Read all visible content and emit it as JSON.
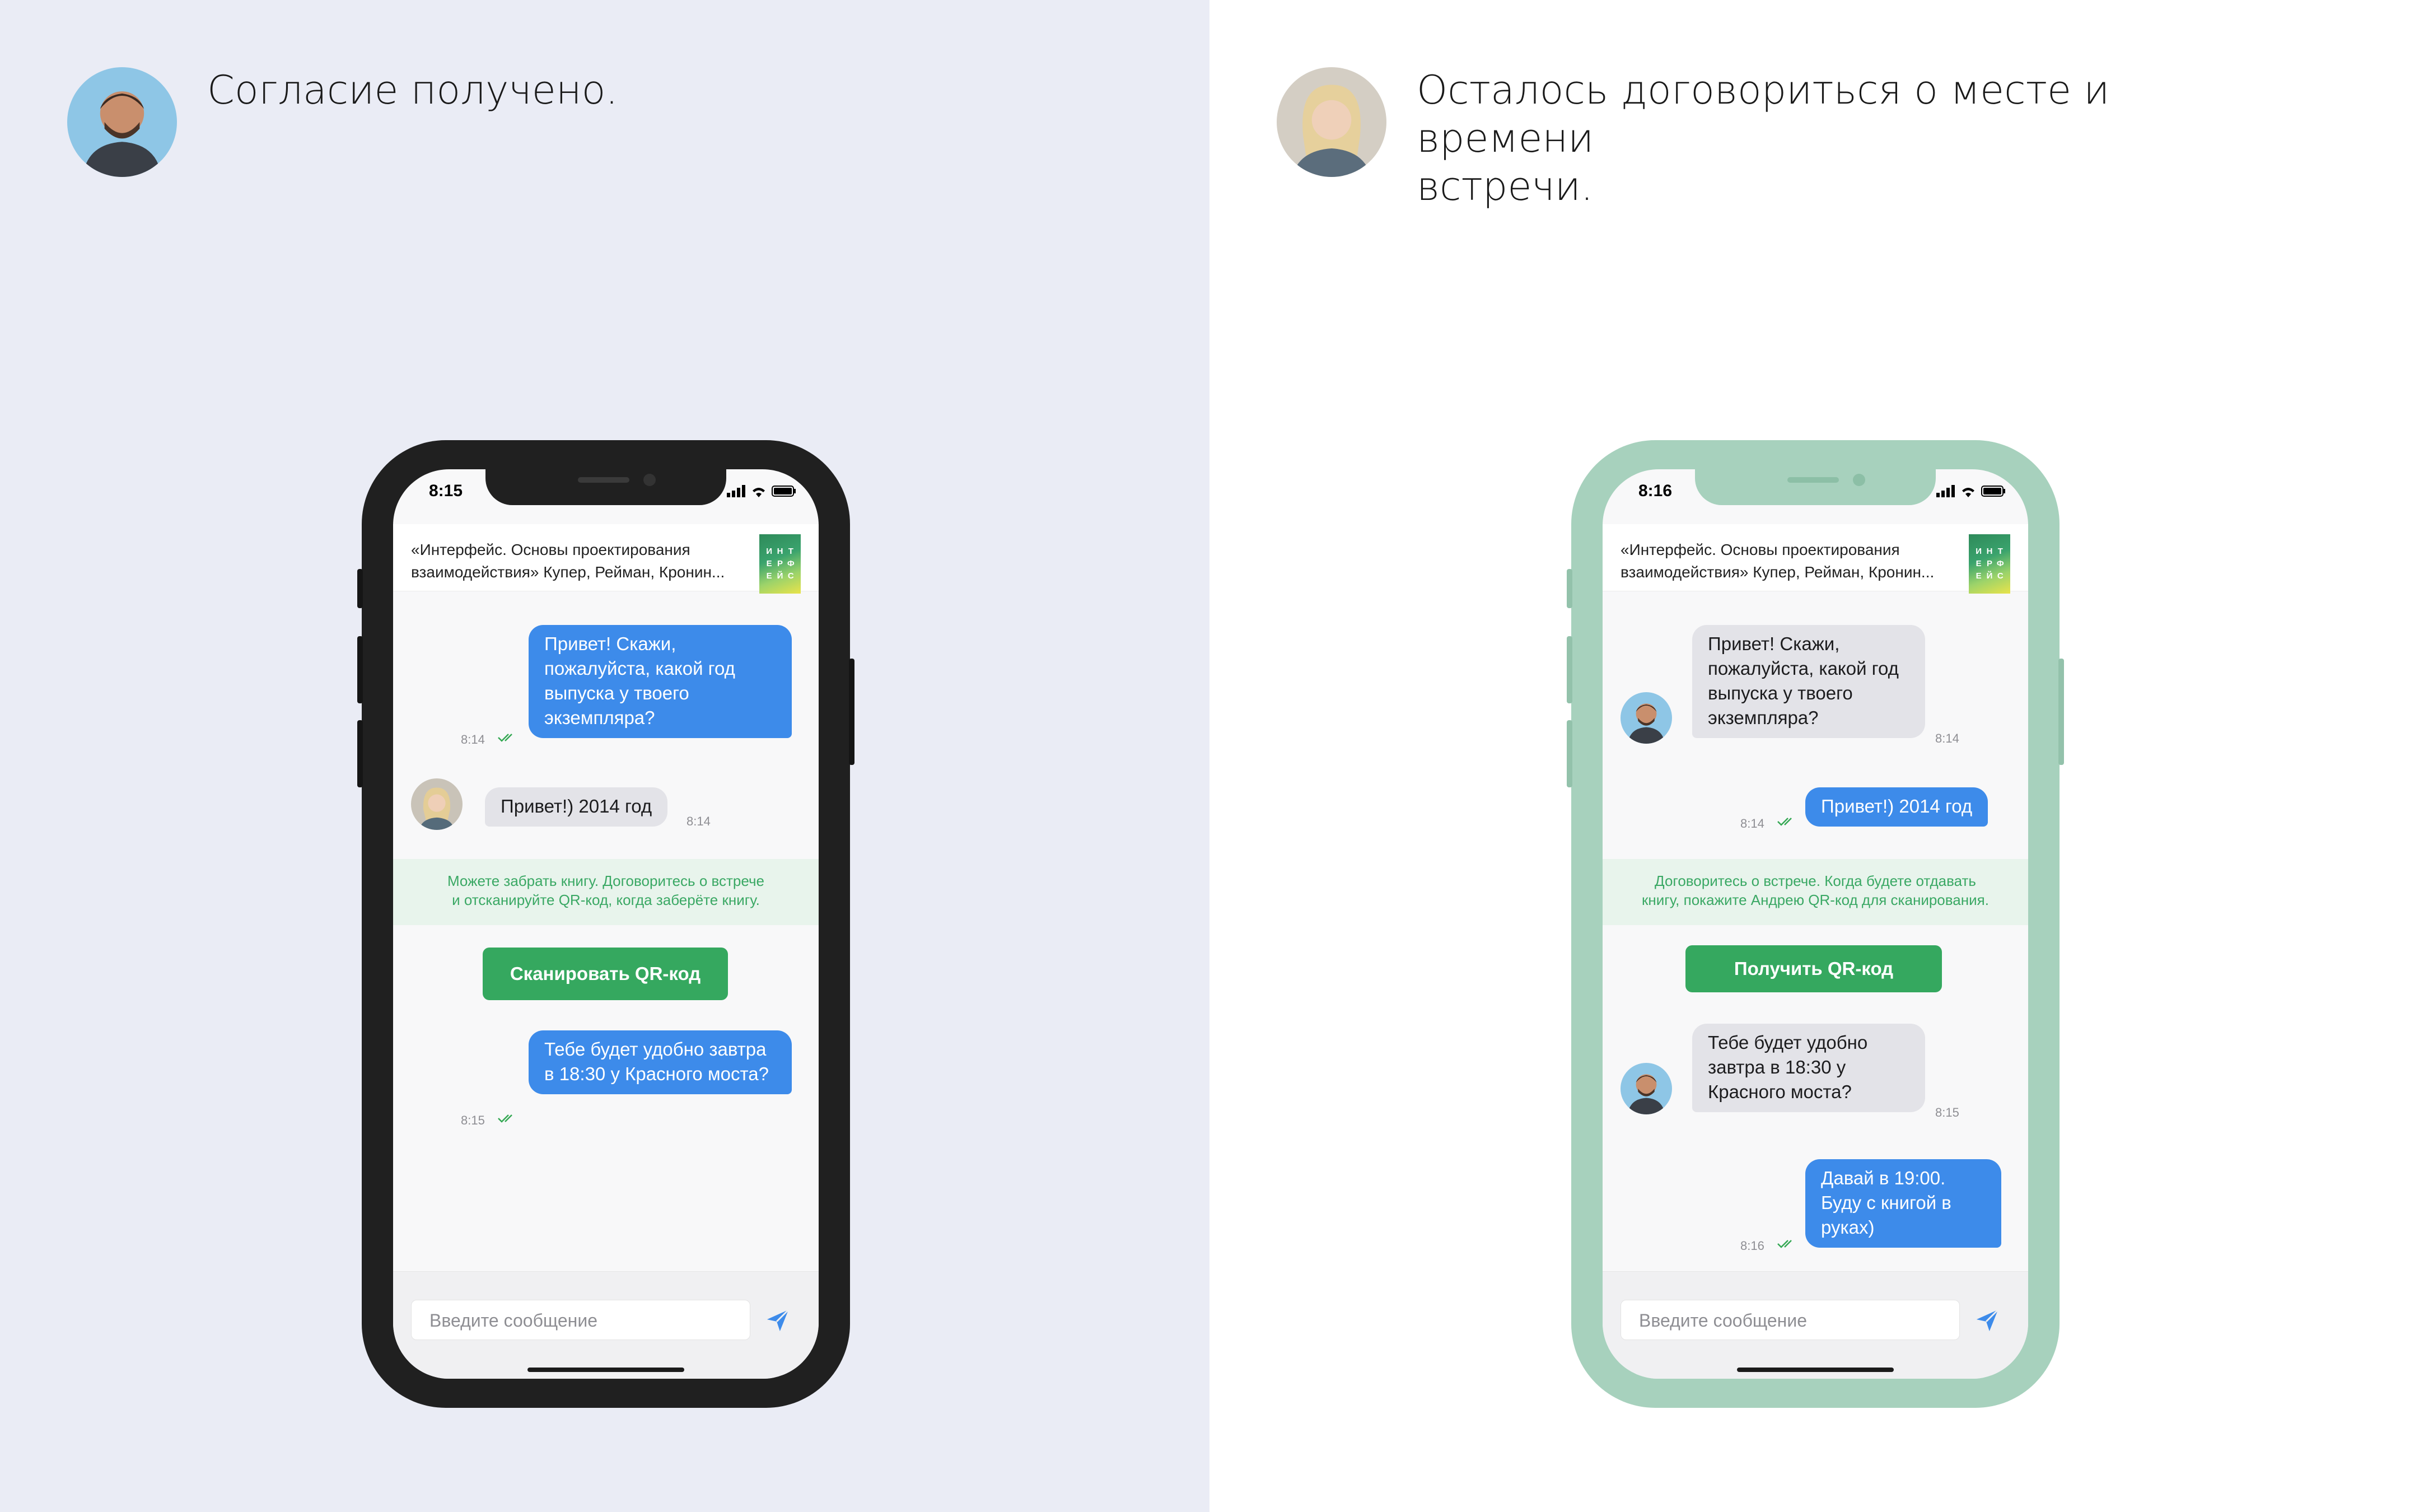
{
  "left": {
    "caption": "Согласие получено.",
    "avatar_icon": "man-avatar",
    "phone": {
      "frame_color": "#202020",
      "status_time": "8:15",
      "book_title": "«Интерфейс. Основы проектирования взаимодействия» Купер, Рейман, Кронин...",
      "book_cover_letters": [
        "И",
        "Н",
        "Т",
        "Е",
        "Р",
        "Ф",
        "Е",
        "Й",
        "С"
      ],
      "messages": [
        {
          "text": "Привет! Скажи, пожалуйста, какой год выпуска у твоего экземпляра?",
          "time": "8:14",
          "direction": "out"
        },
        {
          "text": "Привет!) 2014 год",
          "time": "8:14",
          "direction": "in"
        },
        {
          "text": "Тебе будет удобно завтра в 18:30 у Красного моста?",
          "time": "8:15",
          "direction": "out"
        }
      ],
      "system_note_line1": "Можете забрать книгу. Договоритесь о встрече",
      "system_note_line2": "и отсканируйте QR-код, когда заберёте книгу.",
      "action_label": "Сканировать QR-код",
      "input_placeholder": "Введите сообщение"
    }
  },
  "right": {
    "caption_line1": "Осталось договориться о месте и времени",
    "caption_line2": "встречи.",
    "avatar_icon": "woman-avatar",
    "phone": {
      "frame_color": "#a7d1bd",
      "status_time": "8:16",
      "book_title": "«Интерфейс. Основы проектирования взаимодействия» Купер, Рейман, Кронин...",
      "book_cover_letters": [
        "И",
        "Н",
        "Т",
        "Е",
        "Р",
        "Ф",
        "Е",
        "Й",
        "С"
      ],
      "messages": [
        {
          "text": "Привет! Скажи, пожалуйста, какой год выпуска у твоего экземпляра?",
          "time": "8:14",
          "direction": "in"
        },
        {
          "text": "Привет!) 2014 год",
          "time": "8:14",
          "direction": "out"
        },
        {
          "text": "Тебе будет удобно завтра в 18:30 у Красного моста?",
          "time": "8:15",
          "direction": "in"
        },
        {
          "text": "Давай в 19:00. Буду с книгой в руках)",
          "time": "8:16",
          "direction": "out"
        }
      ],
      "system_note_line1": "Договоритесь о встрече. Когда будете отдавать",
      "system_note_line2": "книгу, покажите Андрею QR-код для сканирования.",
      "action_label": "Получить QR-код",
      "input_placeholder": "Введите сообщение"
    }
  },
  "colors": {
    "accent_blue": "#3d8bea",
    "accent_green": "#35a85f",
    "left_background": "#eaecf5",
    "right_background": "#ffffff"
  }
}
